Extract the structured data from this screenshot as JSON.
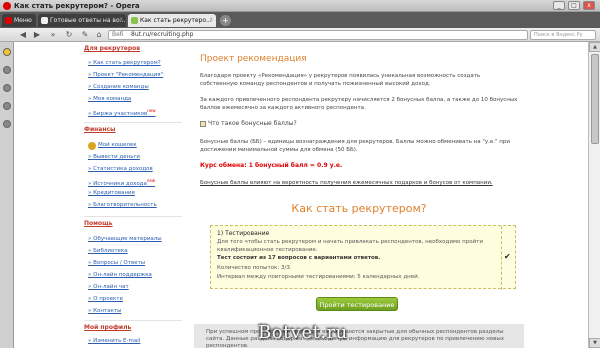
{
  "window": {
    "title": "Как стать рекрутером? - Opera",
    "min_label": "_",
    "max_label": "□",
    "close_label": "x"
  },
  "tabs": [
    {
      "label": "Меню"
    },
    {
      "label": "Готовые ответы на во..."
    },
    {
      "label": "Как стать рекрутеро..."
    }
  ],
  "addressbar": {
    "web_label": "Веб",
    "url": "8ut.ru/recruiting.php",
    "search_placeholder": "Поиск в Яндекс.Ру"
  },
  "menu": {
    "recruiters": {
      "title": "Для рекрутеров",
      "items": [
        {
          "label": "Как стать рекрутером?"
        },
        {
          "label": "Проект \"Рекомендация\""
        },
        {
          "label": "Создание команды"
        },
        {
          "label": "Моя команда"
        },
        {
          "label": "Биржа участников",
          "badge": "new"
        }
      ]
    },
    "finance": {
      "title": "Финансы",
      "sub_title": "Мой кошелек",
      "items": [
        {
          "label": "Вывести деньги"
        },
        {
          "label": "Статистика доходов"
        },
        {
          "label": "Источники дохода",
          "badge": "new"
        },
        {
          "label": "Кредитование"
        },
        {
          "label": "Благотворительность"
        }
      ]
    },
    "help": {
      "title": "Помощь",
      "items": [
        {
          "label": "Обучающие материалы"
        },
        {
          "label": "Библиотека"
        },
        {
          "label": "Вопросы / Ответы"
        },
        {
          "label": "Он-лайн поддержка"
        },
        {
          "label": "Он-лайн чат"
        },
        {
          "label": "О проекте"
        },
        {
          "label": "Контакты"
        }
      ]
    },
    "profile": {
      "title": "Мой профиль",
      "items": [
        {
          "label": "Изменить E-mail"
        }
      ]
    }
  },
  "content": {
    "project_title": "Проект рекомендация",
    "intro_p1": "Благодаря проекту «Рекомендация» у рекрутеров появилась уникальная возможность создать собственную команду респондентов и получать пожизненный высокий доход.",
    "intro_p2": "За каждого привлеченного респондента рекрутеру начисляется 2 бонусных балла, а также до 10 бонусных баллов ежемесячно за каждого активного респондента.",
    "bonus_question": "Что такое бонусные баллы?",
    "bonus_def": "Бонусные баллы (ББ) – единицы вознаграждения для рекрутеров. Баллы можно обменивать на \"у.е.\" при достижении минимальной суммы для обмена (50 ББ).",
    "rate": "Курс обмена: 1 бонусный балл = 0.9 у.е.",
    "influence_note": "Бонусные баллы влияют на вероятность получения ежемесячных подарков и бонусов от компании.",
    "how_title": "Как стать рекрутером?",
    "test": {
      "title": "1) Тестирование",
      "line1": "Для того чтобы стать рекрутером и начать привлекать респондентов, необходимо пройти квалификационное тестирование.",
      "line2": "Тест состоит из 17 вопросов с вариантами ответов.",
      "line3": "Количество попыток: 3/3.",
      "line4": "Интервал между повторными тестированиями: 5 календарных дней.",
      "done_mark": "✔"
    },
    "start_button": "Пройти тестирование",
    "footer_note": "При успешном прохождении теста для вас откроются закрытые для обычных респондентов разделы сайта. Данные разделы содержат необходимую информацию для рекрутеров по привлечению новых респондентов.",
    "watermark": "Botvet.ru"
  }
}
